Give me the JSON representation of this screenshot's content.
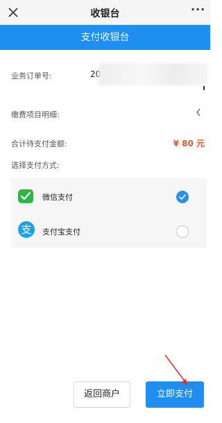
{
  "topbar": {
    "title": "收银台",
    "more": "···",
    "close_icon": "close-icon"
  },
  "banner": {
    "title": "支付收银台"
  },
  "order": {
    "label": "业务订单号:",
    "value": "20"
  },
  "items": {
    "label": "缴费项目明细:"
  },
  "total": {
    "label": "合计待支付金额:",
    "value": "¥ 80 元"
  },
  "method": {
    "label": "选择支付方式:"
  },
  "payment": {
    "options": [
      {
        "label": "微信支付",
        "icon": "wechat-pay-icon",
        "selected": true
      },
      {
        "label": "支付宝支付",
        "icon": "alipay-icon",
        "glyph": "支",
        "selected": false
      }
    ]
  },
  "actions": {
    "back_label": "返回商户",
    "pay_label": "立即支付"
  },
  "colors": {
    "accent": "#1e8ff0",
    "amount": "#e4572e",
    "annotation": "#e32b2b"
  }
}
